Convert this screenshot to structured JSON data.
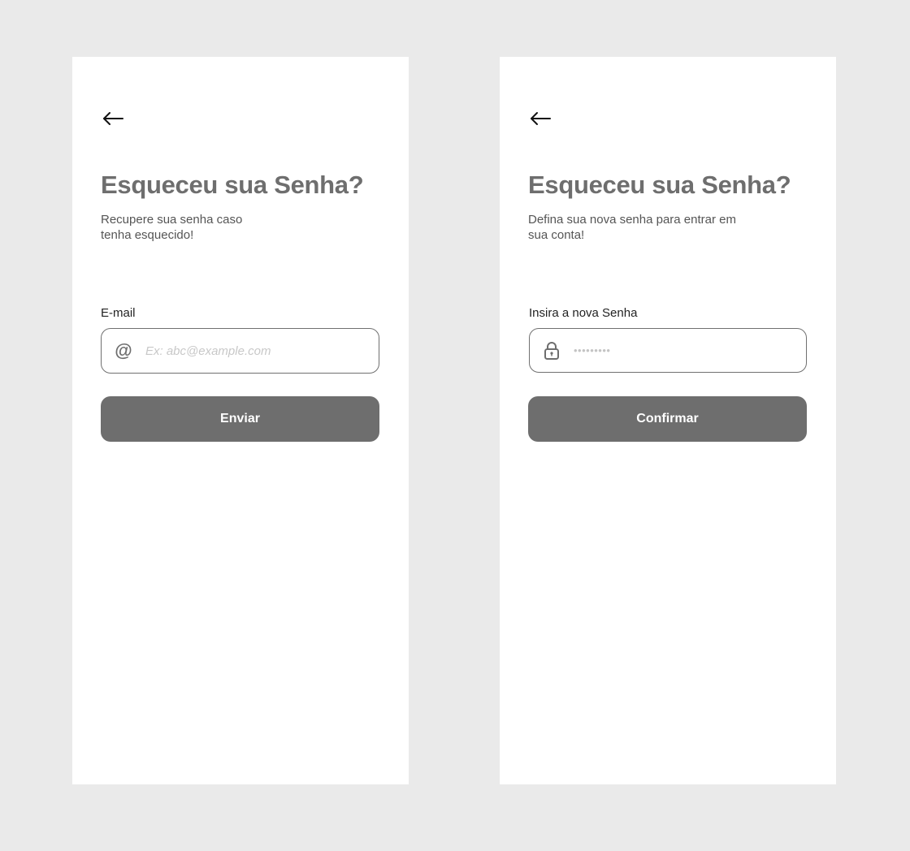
{
  "colors": {
    "background": "#eaeaea",
    "screen": "#ffffff",
    "primary": "#6e6e6e",
    "input_border": "#707070",
    "placeholder": "#c8c8c8"
  },
  "screens": [
    {
      "back_icon": "arrow-left-icon",
      "title": "Esqueceu sua Senha?",
      "subtitle_lines": [
        "Recupere sua senha caso",
        "tenha esquecido!"
      ],
      "field_label": "E-mail",
      "field_icon": "at-icon",
      "at_glyph": "@",
      "field_placeholder": "Ex: abc@example.com",
      "button_label": "Enviar"
    },
    {
      "back_icon": "arrow-left-icon",
      "title": "Esqueceu sua Senha?",
      "subtitle_lines": [
        "Defina sua nova senha para entrar em",
        "sua conta!"
      ],
      "field_label": "Insira a nova Senha",
      "field_icon": "lock-icon",
      "field_masked_value": "•••••••••",
      "button_label": "Confirmar"
    }
  ]
}
